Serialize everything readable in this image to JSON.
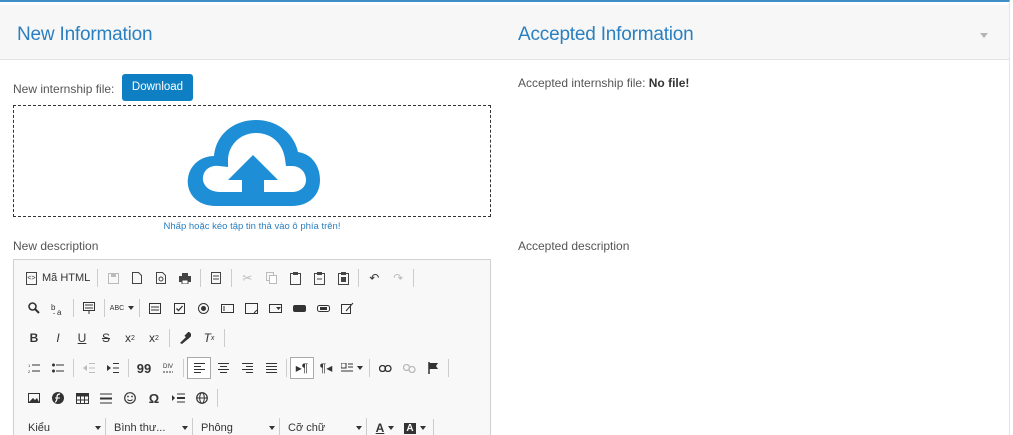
{
  "header": {
    "new_title": "New Information",
    "accepted_title": "Accepted Information"
  },
  "left": {
    "file_label": "New internship file:",
    "download_label": "Download",
    "dropzone_hint": "Nhấp hoặc kéo tập tin thả vào ô phía trên!",
    "description_label": "New description"
  },
  "right": {
    "file_label": "Accepted internship file:",
    "file_value": "No file!",
    "description_label": "Accepted description"
  },
  "toolbar": {
    "source_label": "Mã HTML",
    "style_combo": "Kiểu",
    "format_combo": "Bình thư...",
    "font_combo": "Phông",
    "size_combo": "Cỡ chữ",
    "bold_glyph": "B",
    "italic_glyph": "I",
    "underline_glyph": "U",
    "strike_glyph": "S",
    "subscript_glyph": "x",
    "superscript_glyph": "x",
    "sub_mark": "2",
    "sup_mark": "2",
    "removeformat_glyph": "T",
    "removeformat_mark": "x",
    "blockquote_glyph": "99",
    "omega_glyph": "Ω",
    "spellcheck_glyph": "ABC",
    "text_color_glyph": "A",
    "bg_color_glyph": "A",
    "html_badge": "<>"
  },
  "colors": {
    "accent": "#2a7fc0",
    "button": "#0f7fc4",
    "cloud": "#1e8fd6",
    "header_border": "#3d8fc6"
  }
}
